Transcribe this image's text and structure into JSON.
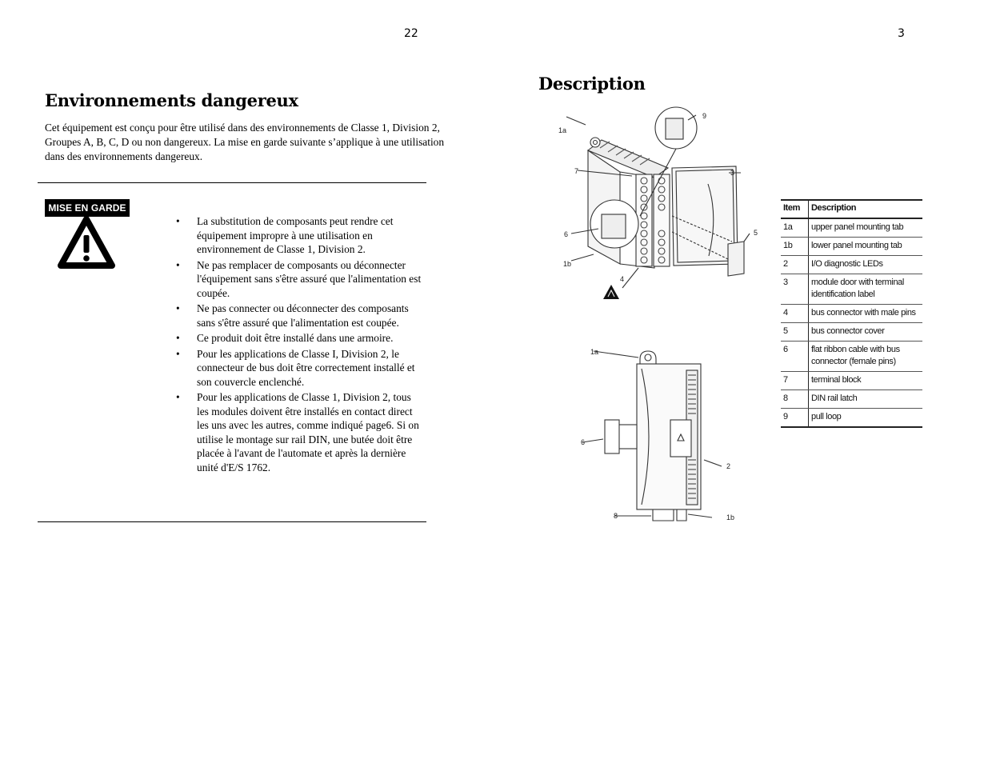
{
  "left_page": {
    "page_number": "22",
    "title": "Environnements dangereux",
    "intro": "Cet équipement est conçu pour être utilisé dans des environnements de Classe 1, Division 2, Groupes A, B, C, D ou non dangereux. La mise en garde suivante s’applique à une utilisation dans des environnements dangereux.",
    "warning": {
      "badge": "MISE EN GARDE",
      "icon": "warning-triangle-icon",
      "bullet_glyph": "•",
      "items": [
        "La substitution de composants peut rendre cet équipement impropre à une utilisation en environnement de Classe 1, Division 2.",
        "Ne pas remplacer de composants ou déconnecter l'équipement sans s'être assuré que l'alimentation est coupée.",
        "Ne pas connecter ou déconnecter des composants sans s'être assuré que l'alimentation est coupée.",
        "Ce produit doit être installé dans une armoire.",
        "Pour les applications de Classe I, Division 2, le connecteur de bus doit être correctement installé et son couvercle enclenché.",
        "Pour les applications de Classe 1, Division 2, tous les modules doivent être installés en contact direct les uns avec les autres, comme indiqué page6. Si on utilise le montage sur rail DIN, une butée doit être placée à l'avant de l'automate et après la dernière unité d'E/S 1762."
      ]
    }
  },
  "right_page": {
    "page_number": "3",
    "title": "Description",
    "figure_isometric": {
      "callouts": [
        "1a",
        "7",
        "6",
        "1b",
        "9",
        "3",
        "5",
        "4"
      ],
      "icon": "esd-warning-icon"
    },
    "figure_front": {
      "callouts": [
        "1a",
        "6",
        "2",
        "8",
        "1b"
      ]
    },
    "table": {
      "headers": [
        "Item",
        "Description"
      ],
      "rows": [
        [
          "1a",
          "upper panel mounting tab"
        ],
        [
          "1b",
          "lower panel mounting tab"
        ],
        [
          "2",
          "I/O diagnostic LEDs"
        ],
        [
          "3",
          "module door with terminal identification label"
        ],
        [
          "4",
          "bus connector with male pins"
        ],
        [
          "5",
          "bus connector cover"
        ],
        [
          "6",
          "flat ribbon cable with bus connector (female pins)"
        ],
        [
          "7",
          "terminal block"
        ],
        [
          "8",
          "DIN rail latch"
        ],
        [
          "9",
          "pull loop"
        ]
      ]
    }
  }
}
